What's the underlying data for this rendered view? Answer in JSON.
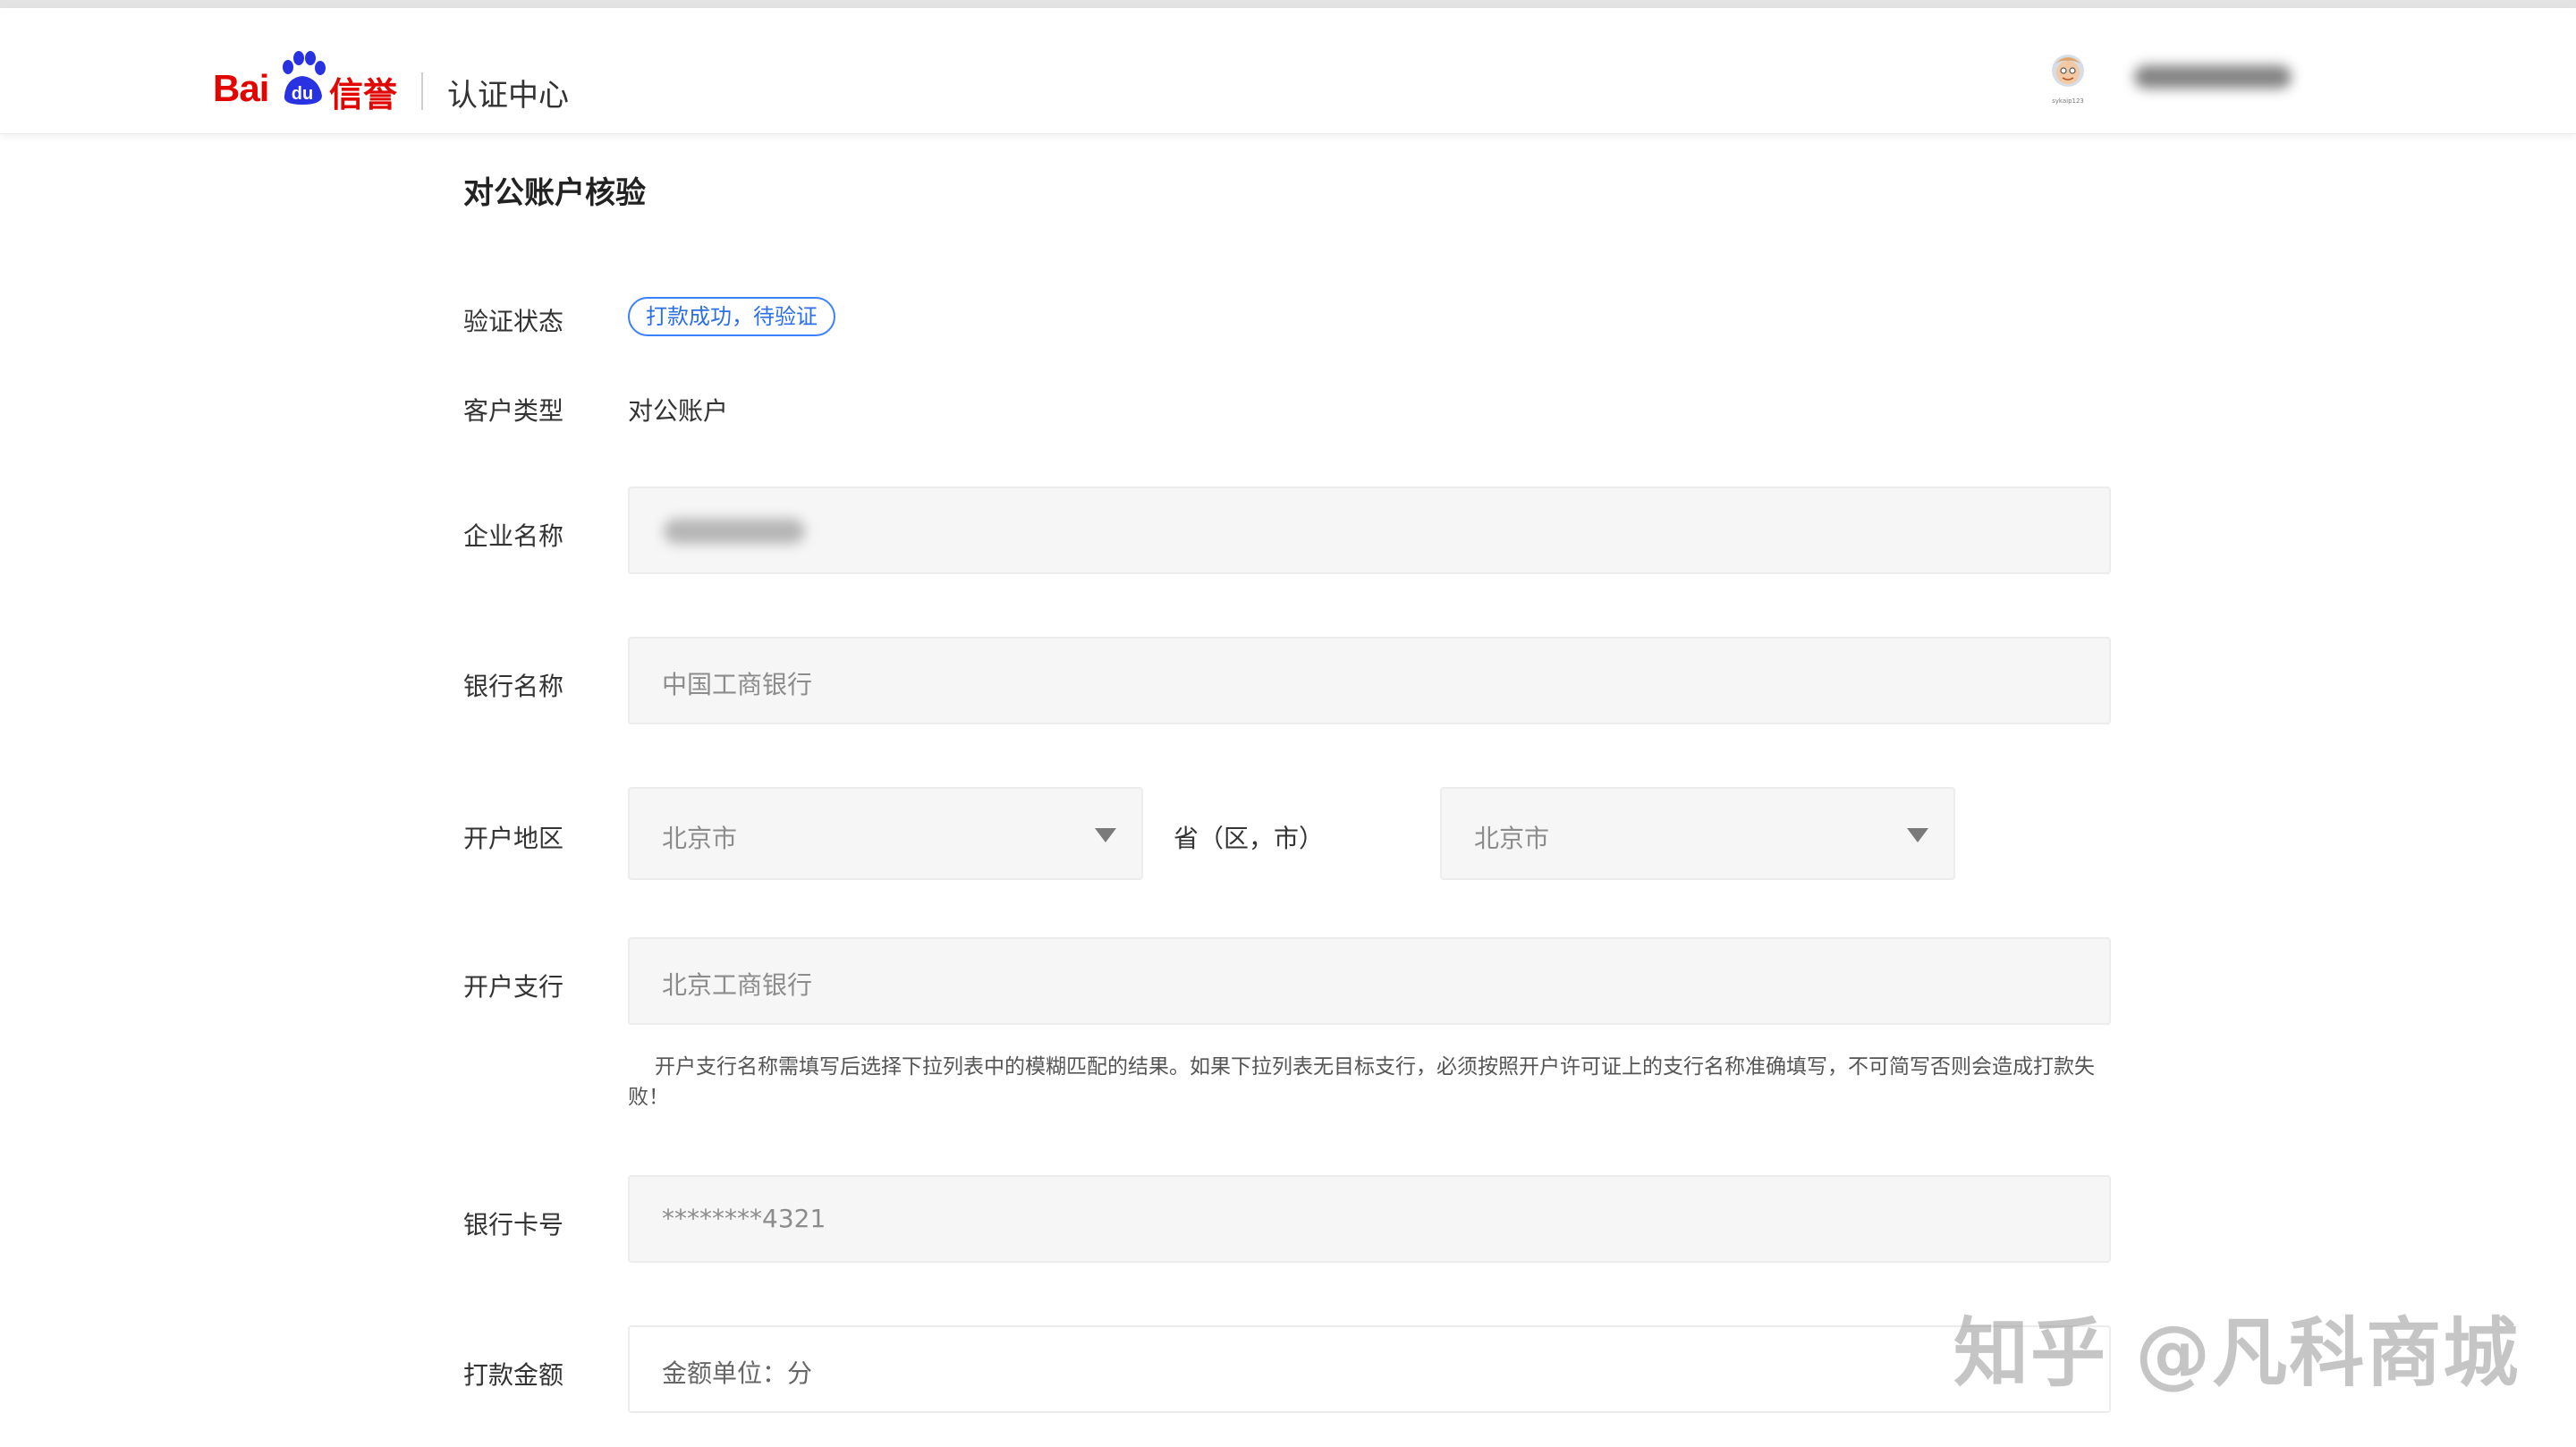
{
  "header": {
    "logo_text": "Bai",
    "logo_brand": "信誉",
    "logo_paw_text": "du",
    "title": "认证中心",
    "avatar_caption": "sykaip123",
    "username": "██████"
  },
  "page": {
    "title": "对公账户核验"
  },
  "form": {
    "status": {
      "label": "验证状态",
      "badge": "打款成功，待验证",
      "badge_color": "#3a80ff"
    },
    "customer_type": {
      "label": "客户类型",
      "value": "对公账户"
    },
    "company_name": {
      "label": "企业名称",
      "value": "█████"
    },
    "bank_name": {
      "label": "银行名称",
      "value": "中国工商银行"
    },
    "region": {
      "label": "开户地区",
      "province": "北京市",
      "unit_label": "省（区，市）",
      "city": "北京市"
    },
    "branch": {
      "label": "开户支行",
      "value": "北京工商银行",
      "hint": "开户支行名称需填写后选择下拉列表中的模糊匹配的结果。如果下拉列表无目标支行，必须按照开户许可证上的支行名称准确填写，不可简写否则会造成打款失败！"
    },
    "card_number": {
      "label": "银行卡号",
      "value": "********4321"
    },
    "amount": {
      "label": "打款金额",
      "placeholder": "金额单位：分"
    }
  },
  "watermark": "知乎 @凡科商城"
}
